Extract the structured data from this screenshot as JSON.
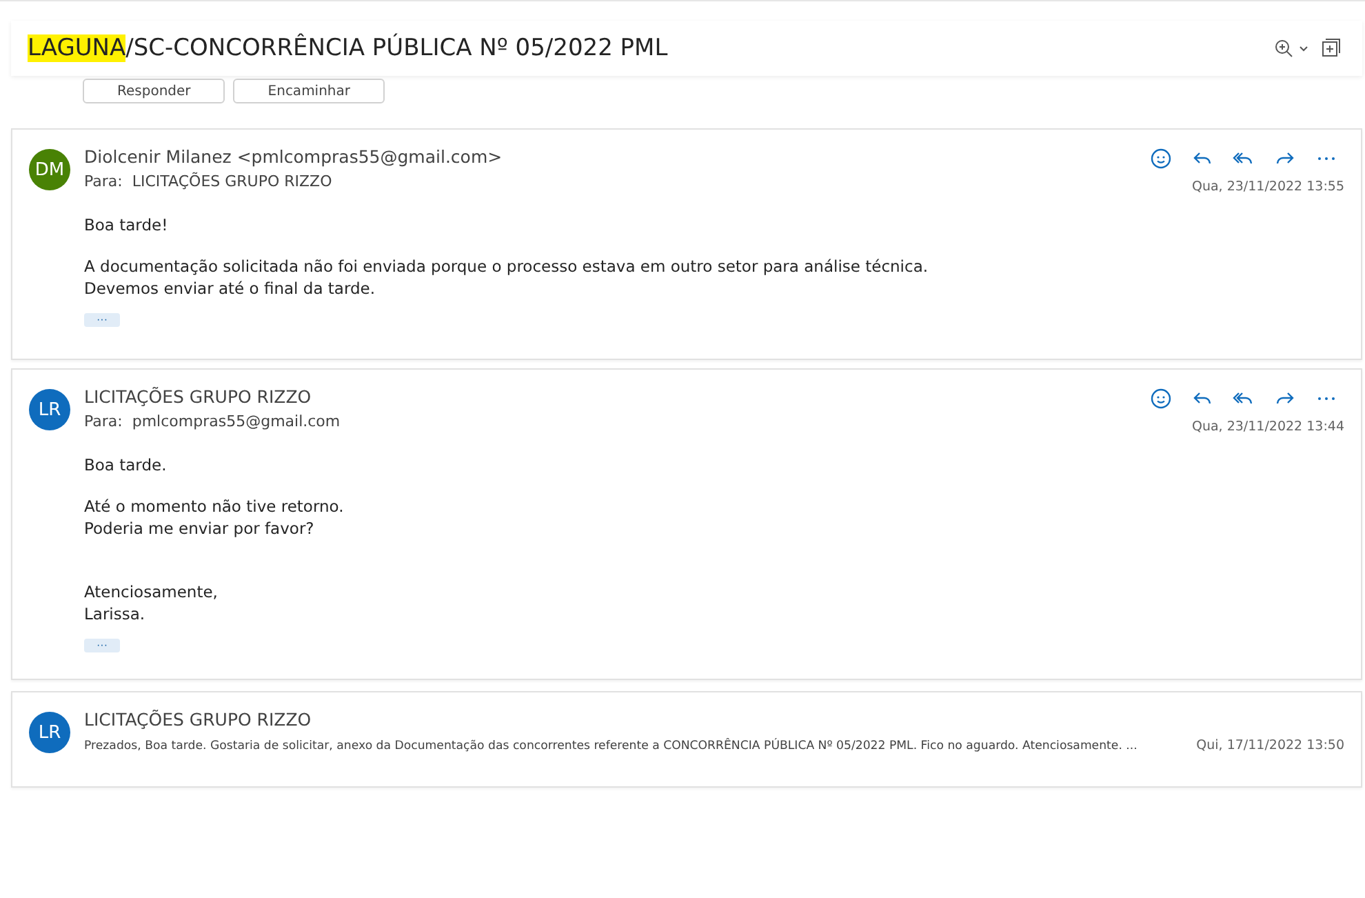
{
  "subject": {
    "highlight": "LAGUNA",
    "rest": "/SC-CONCORRÊNCIA PÚBLICA Nº 05/2022 PML"
  },
  "actions": [
    "Responder",
    "Encaminhar"
  ],
  "messages": [
    {
      "kind": "expanded",
      "initials": "DM",
      "color": "#498205",
      "sender": "Diolcenir Milanez <pmlcompras55@gmail.com>",
      "to_label": "Para:",
      "to": "LICITAÇÕES GRUPO RIZZO",
      "date": "Qua, 23/11/2022 13:55",
      "body": [
        [
          "Boa tarde!"
        ],
        [
          "A documentação solicitada não foi enviada porque o processo estava em outro setor para análise técnica.",
          "Devemos enviar até o final da tarde."
        ]
      ],
      "more": "···"
    },
    {
      "kind": "expanded",
      "initials": "LR",
      "color": "#0f6cbd",
      "sender": "LICITAÇÕES GRUPO RIZZO",
      "to_label": "Para:",
      "to": "pmlcompras55@gmail.com",
      "date": "Qua, 23/11/2022 13:44",
      "body": [
        [
          "Boa tarde."
        ],
        [
          "Até o momento não tive retorno.",
          "Poderia me enviar por favor?"
        ],
        {
          "kind": "spaced",
          "lines": [
            "Atenciosamente,",
            "Larissa."
          ]
        }
      ],
      "more": "···"
    },
    {
      "kind": "collapsed",
      "initials": "LR",
      "color": "#0f6cbd",
      "sender": "LICITAÇÕES GRUPO RIZZO",
      "preview": "Prezados, Boa tarde. Gostaria de solicitar, anexo da Documentação das concorrentes referente a CONCORRÊNCIA PÚBLICA Nº 05/2022 PML. Fico no aguardo. Atenciosamente. ...",
      "date": "Qui, 17/11/2022 13:50"
    }
  ]
}
